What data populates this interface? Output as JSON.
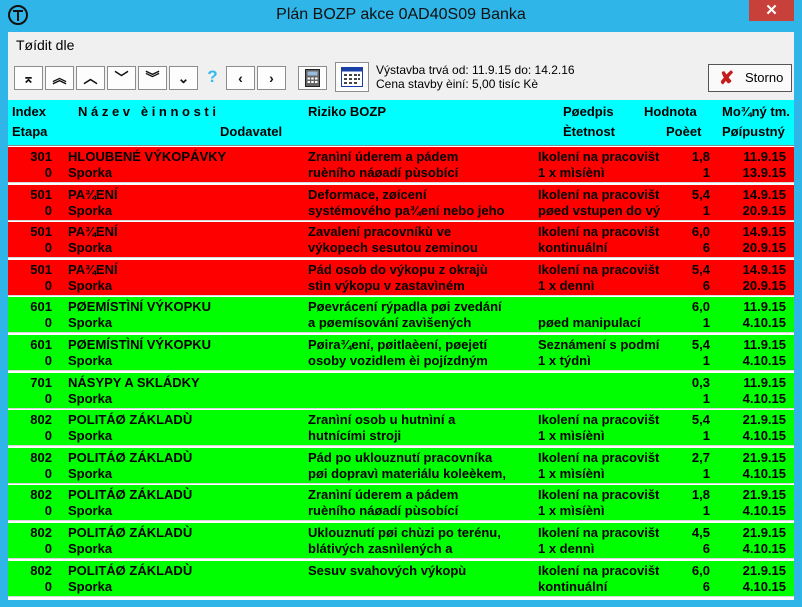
{
  "window": {
    "title": "Plán BOZP akce 0AD40S09 Banka",
    "close_glyph": "✕"
  },
  "menu": {
    "sort_label": "Tøídit dle"
  },
  "toolbar": {
    "buttons": [
      "⌅",
      "︽",
      "︿",
      "﹀",
      "︾",
      "⌄",
      "?",
      "‹",
      "›"
    ],
    "info_line1": "Výstavba trvá  od: 11.9.15 do: 14.2.16",
    "info_line2": "Cena stavby èiní: 5,00 tisíc Kè",
    "storno_label": "Storno",
    "storno_glyph": "✘"
  },
  "table": {
    "headers": {
      "index": "Index",
      "etapa": "Etapa",
      "nazev": "N á z e v   è i n n o s t i",
      "dodavatel": "Dodavatel",
      "riziko": "Riziko BOZP",
      "predpis": "Pøedpis",
      "cetnost": "Ètetnost",
      "hodnota": "Hodnota",
      "pocet": "Poèet",
      "mozny": "Mo¾ný tm.",
      "pripustny": "Pøípustný"
    },
    "rows": [
      {
        "color": "red",
        "index": "301",
        "etapa": "0",
        "nazev": "HLOUBENÉ VÝKOPÁVKY",
        "dodavatel": "Sporka",
        "riziko1": "Zranìní úderem a pádem",
        "riziko2": "ruèního náøadí pùsobící",
        "predpis1": "Ikolení na pracovišt",
        "predpis2": "1 x mìsíènì",
        "hodnota": "1,8",
        "pocet": "1",
        "mozny": "11.9.15",
        "pripustny": "13.9.15"
      },
      {
        "color": "red",
        "index": "501",
        "etapa": "0",
        "nazev": "PA¾ENÍ",
        "dodavatel": "Sporka",
        "riziko1": "Deformace, zøícení",
        "riziko2": "systémového pa¾ení nebo jeho",
        "predpis1": "Ikolení na pracovišt",
        "predpis2": "pøed vstupen do vý",
        "hodnota": "5,4",
        "pocet": "1",
        "mozny": "14.9.15",
        "pripustny": "20.9.15"
      },
      {
        "color": "red",
        "index": "501",
        "etapa": "0",
        "nazev": "PA¾ENÍ",
        "dodavatel": "Sporka",
        "riziko1": "Zavalení pracovníkù ve",
        "riziko2": "výkopech sesutou zeminou",
        "predpis1": "Ikolení na pracovišt",
        "predpis2": "kontinuální",
        "hodnota": "6,0",
        "pocet": "6",
        "mozny": "14.9.15",
        "pripustny": "20.9.15"
      },
      {
        "color": "red",
        "index": "501",
        "etapa": "0",
        "nazev": "PA¾ENÍ",
        "dodavatel": "Sporka",
        "riziko1": "Pád osob do výkopu z okrajù",
        "riziko2": "stìn výkopu v zastavìném",
        "predpis1": "Ikolení na pracovišt",
        "predpis2": "1 x dennì",
        "hodnota": "5,4",
        "pocet": "6",
        "mozny": "14.9.15",
        "pripustny": "20.9.15"
      },
      {
        "color": "green",
        "index": "601",
        "etapa": "0",
        "nazev": "PØEMÍSTÌNÍ VÝKOPKU",
        "dodavatel": "Sporka",
        "riziko1": "Pøevrácení rýpadla pøi zvedání",
        "riziko2": "a pøemísování zavìšených",
        "predpis1": "",
        "predpis2": "pøed manipulací",
        "hodnota": "6,0",
        "pocet": "1",
        "mozny": "11.9.15",
        "pripustny": "4.10.15"
      },
      {
        "color": "green",
        "index": "601",
        "etapa": "0",
        "nazev": "PØEMÍSTÌNÍ VÝKOPKU",
        "dodavatel": "Sporka",
        "riziko1": "Pøira¾ení, pøitlaèení, pøejetí",
        "riziko2": "osoby vozidlem èi pojízdným",
        "predpis1": "Seznámení s podmí",
        "predpis2": "1 x týdnì",
        "hodnota": "5,4",
        "pocet": "1",
        "mozny": "11.9.15",
        "pripustny": "4.10.15"
      },
      {
        "color": "green",
        "index": "701",
        "etapa": "0",
        "nazev": "NÁSYPY A SKLÁDKY",
        "dodavatel": "Sporka",
        "riziko1": "",
        "riziko2": "",
        "predpis1": "",
        "predpis2": "",
        "hodnota": "0,3",
        "pocet": "1",
        "mozny": "11.9.15",
        "pripustny": "4.10.15"
      },
      {
        "color": "green",
        "index": "802",
        "etapa": "0",
        "nazev": "POLITÁØ ZÁKLADÙ",
        "dodavatel": "Sporka",
        "riziko1": "Zranìní osob u hutnìní a",
        "riziko2": "hutnícími stroji",
        "predpis1": "Ikolení na pracovišt",
        "predpis2": "1 x mìsíènì",
        "hodnota": "5,4",
        "pocet": "1",
        "mozny": "21.9.15",
        "pripustny": "4.10.15"
      },
      {
        "color": "green",
        "index": "802",
        "etapa": "0",
        "nazev": "POLITÁØ ZÁKLADÙ",
        "dodavatel": "Sporka",
        "riziko1": "Pád po uklouznutí pracovníka",
        "riziko2": "pøi dopravì materiálu koleèkem,",
        "predpis1": "Ikolení na pracovišt",
        "predpis2": "1 x mìsíènì",
        "hodnota": "2,7",
        "pocet": "1",
        "mozny": "21.9.15",
        "pripustny": "4.10.15"
      },
      {
        "color": "green",
        "index": "802",
        "etapa": "0",
        "nazev": "POLITÁØ ZÁKLADÙ",
        "dodavatel": "Sporka",
        "riziko1": "Zranìní úderem a pádem",
        "riziko2": "ruèního náøadí pùsobící",
        "predpis1": "Ikolení na pracovišt",
        "predpis2": "1 x mìsíènì",
        "hodnota": "1,8",
        "pocet": "1",
        "mozny": "21.9.15",
        "pripustny": "4.10.15"
      },
      {
        "color": "green",
        "index": "802",
        "etapa": "0",
        "nazev": "POLITÁØ ZÁKLADÙ",
        "dodavatel": "Sporka",
        "riziko1": "Uklouznutí pøi chùzi po terénu,",
        "riziko2": "blátivých zasnìlených a",
        "predpis1": "Ikolení na pracovišt",
        "predpis2": "1 x dennì",
        "hodnota": "4,5",
        "pocet": "6",
        "mozny": "21.9.15",
        "pripustny": "4.10.15"
      },
      {
        "color": "green",
        "index": "802",
        "etapa": "0",
        "nazev": "POLITÁØ ZÁKLADÙ",
        "dodavatel": "Sporka",
        "riziko1": "Sesuv svahových výkopù",
        "riziko2": "",
        "predpis1": "Ikolení na pracovišt",
        "predpis2": "kontinuální",
        "hodnota": "6,0",
        "pocet": "6",
        "mozny": "21.9.15",
        "pripustny": "4.10.15"
      }
    ]
  },
  "colors": {
    "titlebar": "#2fb5e8",
    "header": "#00ffff",
    "row_red": "#ff0000",
    "row_green": "#00ff00",
    "close": "#c7403a"
  }
}
